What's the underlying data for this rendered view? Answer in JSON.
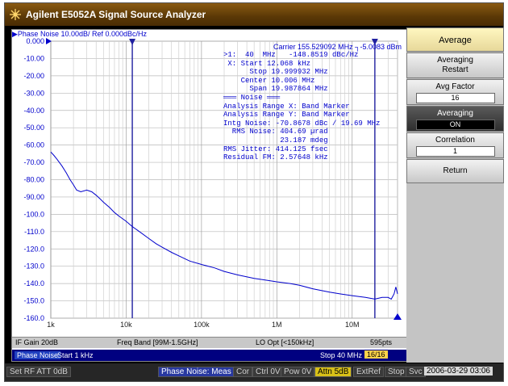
{
  "app": {
    "title": "Agilent E5052A Signal Source Analyzer"
  },
  "trace_header": "▶Phase Noise 10.00dB/ Ref 0.000dBc/Hz",
  "carrier": "Carrier 155.529092 MHz  ┐-5.0083 dBm",
  "chart_data": {
    "type": "line",
    "xscale": "log",
    "xlim": [
      1000,
      40000000
    ],
    "ylim": [
      -160,
      0
    ],
    "yticks": [
      "0.000",
      "-10.00",
      "-20.00",
      "-30.00",
      "-40.00",
      "-50.00",
      "-60.00",
      "-70.00",
      "-80.00",
      "-90.00",
      "-100.0",
      "-110.0",
      "-120.0",
      "-130.0",
      "-140.0",
      "-150.0",
      "-160.0"
    ],
    "xticks": [
      "1k",
      "10k",
      "100k",
      "1M",
      "10M"
    ],
    "markers": [
      {
        "label": "X",
        "x": 12068
      },
      {
        "label": "1",
        "x": 19999932
      }
    ],
    "series": [
      {
        "color": "#0000cc",
        "points": [
          [
            1000,
            -64
          ],
          [
            1100,
            -66
          ],
          [
            1200,
            -68
          ],
          [
            1400,
            -72
          ],
          [
            1600,
            -76
          ],
          [
            1800,
            -80
          ],
          [
            2000,
            -83
          ],
          [
            2200,
            -86
          ],
          [
            2500,
            -87
          ],
          [
            3000,
            -86
          ],
          [
            3500,
            -87
          ],
          [
            4000,
            -89
          ],
          [
            4500,
            -91
          ],
          [
            5000,
            -93
          ],
          [
            6000,
            -96
          ],
          [
            7000,
            -99
          ],
          [
            8000,
            -101
          ],
          [
            10000,
            -104
          ],
          [
            12000,
            -107
          ],
          [
            15000,
            -110
          ],
          [
            20000,
            -114
          ],
          [
            25000,
            -117
          ],
          [
            30000,
            -119
          ],
          [
            40000,
            -122
          ],
          [
            50000,
            -124
          ],
          [
            70000,
            -127
          ],
          [
            100000,
            -129
          ],
          [
            150000,
            -131
          ],
          [
            200000,
            -133
          ],
          [
            300000,
            -135
          ],
          [
            500000,
            -137
          ],
          [
            700000,
            -138
          ],
          [
            1000000,
            -139
          ],
          [
            1500000,
            -140
          ],
          [
            2000000,
            -141
          ],
          [
            3000000,
            -143
          ],
          [
            5000000,
            -145
          ],
          [
            7000000,
            -146
          ],
          [
            10000000,
            -147
          ],
          [
            15000000,
            -148
          ],
          [
            20000000,
            -149
          ],
          [
            25000000,
            -148
          ],
          [
            30000000,
            -148
          ],
          [
            33000000,
            -149
          ],
          [
            36000000,
            -146
          ],
          [
            38000000,
            -142
          ],
          [
            40000000,
            -146
          ]
        ]
      }
    ]
  },
  "marker_info": [
    ">1:  40  MHz   -148.8519 dBc/Hz",
    " X: Start 12.068 kHz",
    "      Stop 19.999932 MHz",
    "    Center 10.006 MHz",
    "      Span 19.987864 MHz",
    "═══ Noise ═══",
    "Analysis Range X: Band Marker",
    "Analysis Range Y: Band Marker",
    "Intg Noise: -70.8678 dBc / 19.69 MHz",
    "  RMS Noise: 404.69 µrad",
    "             23.187 mdeg",
    "RMS Jitter: 414.125 fsec",
    "Residual FM: 2.57648 kHz"
  ],
  "status": {
    "if_gain": "IF Gain 20dB",
    "freq_band": "Freq Band [99M-1.5GHz]",
    "lo_opt": "LO Opt [<150kHz]",
    "points": "595pts"
  },
  "footer": {
    "mode": "Phase Noise",
    "start": "Start 1 kHz",
    "stop": "Stop 40 MHz",
    "sweep": "16/16"
  },
  "softkeys": {
    "header": "Average",
    "items": [
      {
        "label": "Averaging",
        "sub": "Restart"
      },
      {
        "label": "Avg Factor",
        "value": "16"
      },
      {
        "label": "Averaging",
        "value": "ON"
      },
      {
        "label": "Correlation",
        "value": "1"
      },
      {
        "label": "Return"
      }
    ]
  },
  "bottombar": {
    "left": "Set RF ATT 0dB",
    "mode": "Phase Noise: Meas",
    "flags": [
      "Cor",
      "Ctrl 0V",
      "Pow 0V",
      "Attn 5dB",
      "ExtRef",
      "Stop",
      "Svc"
    ],
    "datetime": "2006-03-29 03:06"
  },
  "colors": {
    "trace": "#0000cc",
    "title_bg": "#5a3806",
    "marker_line": "#2020a0"
  }
}
